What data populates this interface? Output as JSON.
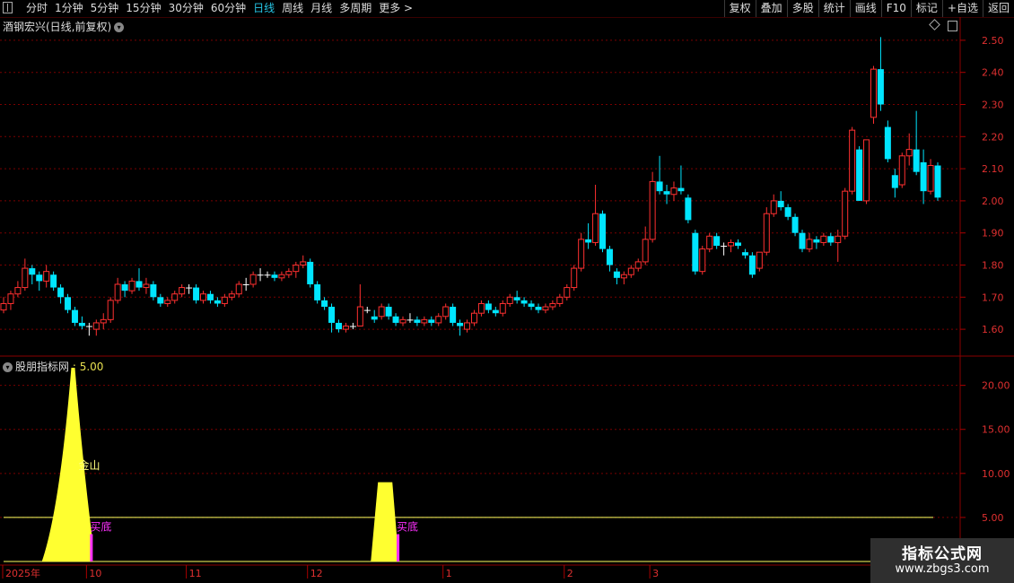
{
  "toolbar": {
    "periods": [
      "分时",
      "1分钟",
      "5分钟",
      "15分钟",
      "30分钟",
      "60分钟",
      "日线",
      "周线",
      "月线",
      "多周期",
      "更多 >"
    ],
    "active_period": "日线",
    "right_buttons": [
      "复权",
      "叠加",
      "多股",
      "统计",
      "画线",
      "F10",
      "标记",
      "+自选",
      "返回"
    ]
  },
  "upper_panel": {
    "title": "酒钢宏兴(日线,前复权)",
    "price_labels": [
      "2.50",
      "2.40",
      "2.30",
      "2.20",
      "2.10",
      "2.00",
      "1.90",
      "1.80",
      "1.70",
      "1.60"
    ]
  },
  "lower_panel": {
    "indicator_name": "股朋指标网",
    "indicator_value": ": 5.00",
    "value_labels": [
      "20.00",
      "15.00",
      "10.00",
      "5.00"
    ],
    "text_jinshan": "金山",
    "text_buy1": "买底",
    "text_buy2": "买底"
  },
  "date_axis": [
    "2025年",
    "10",
    "11",
    "12",
    "1",
    "2",
    "3"
  ],
  "watermark": {
    "line1": "指标公式网",
    "line2": "www.zbgs3.com"
  },
  "colors": {
    "up": "#ff3030",
    "down": "#00e5ff",
    "doji": "#ffffff",
    "grid": "#7a0000",
    "indicator": "#ffff30",
    "buy": "#ff30ff",
    "line": "#ffff60"
  },
  "chart_data": [
    {
      "type": "candlestick",
      "ylim": [
        1.55,
        2.55
      ],
      "candles": [
        [
          1.66,
          1.7,
          1.65,
          1.68
        ],
        [
          1.68,
          1.72,
          1.66,
          1.71
        ],
        [
          1.71,
          1.75,
          1.7,
          1.73
        ],
        [
          1.73,
          1.82,
          1.72,
          1.79
        ],
        [
          1.79,
          1.8,
          1.74,
          1.77
        ],
        [
          1.77,
          1.78,
          1.72,
          1.75
        ],
        [
          1.75,
          1.8,
          1.73,
          1.78
        ],
        [
          1.77,
          1.78,
          1.72,
          1.73
        ],
        [
          1.73,
          1.74,
          1.68,
          1.7
        ],
        [
          1.7,
          1.71,
          1.65,
          1.66
        ],
        [
          1.66,
          1.67,
          1.61,
          1.62
        ],
        [
          1.62,
          1.64,
          1.6,
          1.61
        ],
        [
          1.61,
          1.62,
          1.58,
          1.61
        ],
        [
          1.6,
          1.63,
          1.58,
          1.62
        ],
        [
          1.62,
          1.65,
          1.6,
          1.63
        ],
        [
          1.63,
          1.7,
          1.62,
          1.69
        ],
        [
          1.69,
          1.76,
          1.68,
          1.74
        ],
        [
          1.74,
          1.75,
          1.7,
          1.72
        ],
        [
          1.72,
          1.76,
          1.71,
          1.75
        ],
        [
          1.75,
          1.79,
          1.72,
          1.73
        ],
        [
          1.73,
          1.76,
          1.71,
          1.74
        ],
        [
          1.74,
          1.75,
          1.69,
          1.7
        ],
        [
          1.7,
          1.71,
          1.67,
          1.68
        ],
        [
          1.68,
          1.7,
          1.67,
          1.69
        ],
        [
          1.69,
          1.72,
          1.68,
          1.71
        ],
        [
          1.71,
          1.74,
          1.7,
          1.73
        ],
        [
          1.73,
          1.74,
          1.71,
          1.73
        ],
        [
          1.73,
          1.74,
          1.68,
          1.69
        ],
        [
          1.69,
          1.72,
          1.68,
          1.71
        ],
        [
          1.71,
          1.72,
          1.68,
          1.69
        ],
        [
          1.69,
          1.7,
          1.67,
          1.68
        ],
        [
          1.68,
          1.71,
          1.67,
          1.7
        ],
        [
          1.7,
          1.72,
          1.69,
          1.71
        ],
        [
          1.71,
          1.75,
          1.7,
          1.74
        ],
        [
          1.74,
          1.76,
          1.72,
          1.74
        ],
        [
          1.74,
          1.78,
          1.73,
          1.77
        ],
        [
          1.77,
          1.79,
          1.75,
          1.77
        ],
        [
          1.77,
          1.78,
          1.76,
          1.77
        ],
        [
          1.77,
          1.78,
          1.75,
          1.76
        ],
        [
          1.76,
          1.78,
          1.75,
          1.77
        ],
        [
          1.77,
          1.79,
          1.76,
          1.78
        ],
        [
          1.78,
          1.81,
          1.76,
          1.8
        ],
        [
          1.8,
          1.83,
          1.79,
          1.81
        ],
        [
          1.81,
          1.82,
          1.73,
          1.74
        ],
        [
          1.74,
          1.75,
          1.68,
          1.69
        ],
        [
          1.69,
          1.7,
          1.66,
          1.67
        ],
        [
          1.67,
          1.68,
          1.59,
          1.62
        ],
        [
          1.62,
          1.63,
          1.59,
          1.6
        ],
        [
          1.6,
          1.62,
          1.59,
          1.61
        ],
        [
          1.61,
          1.62,
          1.6,
          1.61
        ],
        [
          1.61,
          1.74,
          1.66,
          1.67
        ],
        [
          1.66,
          1.67,
          1.65,
          1.66
        ],
        [
          1.64,
          1.66,
          1.62,
          1.63
        ],
        [
          1.64,
          1.68,
          1.63,
          1.67
        ],
        [
          1.67,
          1.68,
          1.63,
          1.64
        ],
        [
          1.64,
          1.65,
          1.61,
          1.62
        ],
        [
          1.62,
          1.64,
          1.61,
          1.63
        ],
        [
          1.63,
          1.65,
          1.62,
          1.63
        ],
        [
          1.63,
          1.64,
          1.61,
          1.62
        ],
        [
          1.62,
          1.64,
          1.61,
          1.63
        ],
        [
          1.63,
          1.64,
          1.61,
          1.62
        ],
        [
          1.62,
          1.65,
          1.61,
          1.64
        ],
        [
          1.64,
          1.68,
          1.63,
          1.67
        ],
        [
          1.67,
          1.68,
          1.61,
          1.62
        ],
        [
          1.62,
          1.63,
          1.58,
          1.61
        ],
        [
          1.6,
          1.63,
          1.59,
          1.62
        ],
        [
          1.62,
          1.66,
          1.61,
          1.65
        ],
        [
          1.65,
          1.69,
          1.64,
          1.68
        ],
        [
          1.68,
          1.69,
          1.65,
          1.66
        ],
        [
          1.66,
          1.67,
          1.64,
          1.65
        ],
        [
          1.65,
          1.69,
          1.64,
          1.68
        ],
        [
          1.68,
          1.71,
          1.67,
          1.7
        ],
        [
          1.7,
          1.72,
          1.68,
          1.69
        ],
        [
          1.69,
          1.7,
          1.67,
          1.68
        ],
        [
          1.68,
          1.69,
          1.66,
          1.67
        ],
        [
          1.67,
          1.68,
          1.65,
          1.66
        ],
        [
          1.66,
          1.68,
          1.65,
          1.67
        ],
        [
          1.67,
          1.69,
          1.66,
          1.68
        ],
        [
          1.68,
          1.71,
          1.67,
          1.7
        ],
        [
          1.7,
          1.74,
          1.69,
          1.73
        ],
        [
          1.73,
          1.8,
          1.72,
          1.79
        ],
        [
          1.79,
          1.9,
          1.78,
          1.88
        ],
        [
          1.88,
          1.93,
          1.85,
          1.87
        ],
        [
          1.87,
          2.05,
          1.86,
          1.96
        ],
        [
          1.96,
          1.97,
          1.84,
          1.85
        ],
        [
          1.85,
          1.86,
          1.78,
          1.8
        ],
        [
          1.78,
          1.79,
          1.74,
          1.76
        ],
        [
          1.76,
          1.78,
          1.74,
          1.77
        ],
        [
          1.77,
          1.8,
          1.76,
          1.79
        ],
        [
          1.79,
          1.82,
          1.78,
          1.81
        ],
        [
          1.81,
          1.92,
          1.8,
          1.88
        ],
        [
          1.88,
          2.09,
          1.87,
          2.06
        ],
        [
          2.06,
          2.14,
          2.02,
          2.03
        ],
        [
          2.03,
          2.05,
          1.99,
          2.02
        ],
        [
          2.02,
          2.06,
          2.0,
          2.04
        ],
        [
          2.04,
          2.11,
          2.02,
          2.03
        ],
        [
          2.01,
          2.02,
          1.93,
          1.94
        ],
        [
          1.9,
          1.91,
          1.77,
          1.78
        ],
        [
          1.78,
          1.86,
          1.77,
          1.85
        ],
        [
          1.85,
          1.9,
          1.84,
          1.89
        ],
        [
          1.89,
          1.9,
          1.85,
          1.86
        ],
        [
          1.86,
          1.87,
          1.83,
          1.86
        ],
        [
          1.86,
          1.88,
          1.84,
          1.87
        ],
        [
          1.87,
          1.88,
          1.85,
          1.86
        ],
        [
          1.84,
          1.85,
          1.82,
          1.83
        ],
        [
          1.83,
          1.84,
          1.76,
          1.77
        ],
        [
          1.79,
          1.81,
          1.78,
          1.84
        ],
        [
          1.84,
          1.98,
          1.83,
          1.96
        ],
        [
          1.96,
          2.02,
          1.95,
          2.0
        ],
        [
          2.0,
          2.03,
          1.97,
          1.98
        ],
        [
          1.98,
          1.99,
          1.94,
          1.95
        ],
        [
          1.95,
          1.96,
          1.89,
          1.9
        ],
        [
          1.9,
          1.91,
          1.84,
          1.85
        ],
        [
          1.85,
          1.9,
          1.84,
          1.88
        ],
        [
          1.88,
          1.89,
          1.85,
          1.87
        ],
        [
          1.87,
          1.9,
          1.86,
          1.89
        ],
        [
          1.89,
          1.9,
          1.86,
          1.87
        ],
        [
          1.87,
          1.91,
          1.81,
          1.89
        ],
        [
          1.89,
          2.04,
          1.88,
          2.03
        ],
        [
          2.03,
          2.23,
          2.02,
          2.22
        ],
        [
          2.16,
          2.17,
          2.0,
          2.0
        ],
        [
          2.0,
          2.19,
          1.99,
          2.19
        ],
        [
          2.26,
          2.42,
          2.24,
          2.41
        ],
        [
          2.41,
          2.51,
          2.28,
          2.3
        ],
        [
          2.23,
          2.25,
          2.12,
          2.13
        ],
        [
          2.08,
          2.1,
          2.01,
          2.04
        ],
        [
          2.05,
          2.15,
          2.04,
          2.14
        ],
        [
          2.14,
          2.21,
          2.11,
          2.16
        ],
        [
          2.16,
          2.28,
          2.08,
          2.09
        ],
        [
          2.12,
          2.16,
          1.99,
          2.03
        ],
        [
          2.03,
          2.13,
          2.02,
          2.11
        ],
        [
          2.11,
          2.12,
          2.0,
          2.01
        ]
      ]
    },
    {
      "type": "area",
      "ylim": [
        0,
        22
      ],
      "yellow_peaks": [
        {
          "shape": "triangle",
          "start_index": 6,
          "peak_index": 10,
          "end_index": 12,
          "peak_value": 22
        },
        {
          "shape": "plateau",
          "start_index": 52,
          "end_index": 55,
          "value": 9
        }
      ],
      "reference_line": 5,
      "buy_signals": [
        12,
        55
      ]
    }
  ]
}
